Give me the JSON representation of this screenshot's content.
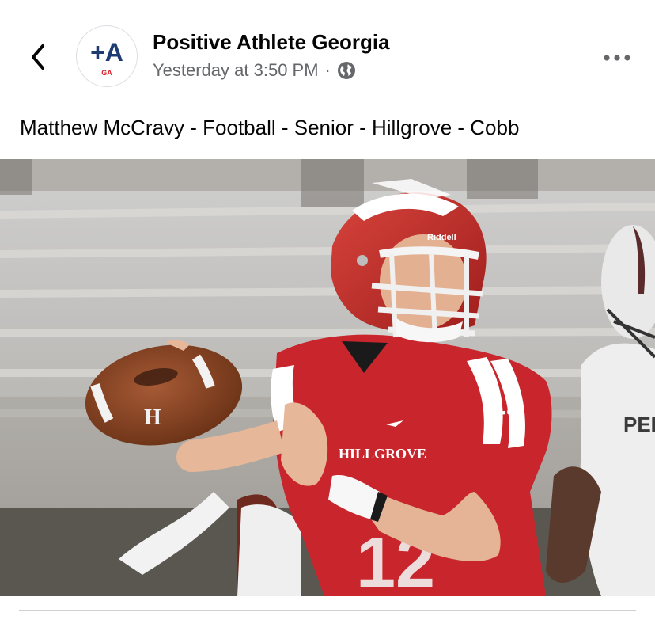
{
  "post": {
    "page_name": "Positive Athlete Georgia",
    "timestamp": "Yesterday at 3:50 PM",
    "separator": "·",
    "audience_icon": "globe-icon",
    "caption": "Matthew McCravy - Football - Senior - Hillgrove - Cobb"
  },
  "avatar": {
    "logo_text": "+A",
    "logo_subtext": "GA"
  },
  "photo": {
    "helmet_brand": "Riddell",
    "jersey_number": "12",
    "jersey_team": "HILLGROVE",
    "ball_logo": "H",
    "opponent_jersey_text": "PEB"
  },
  "icons": {
    "back": "chevron-left-icon",
    "more": "more-horizontal-icon"
  },
  "colors": {
    "jersey_red": "#c8262c",
    "text_secondary": "#65676b",
    "logo_navy": "#1f3b73",
    "logo_red": "#d9232f"
  }
}
